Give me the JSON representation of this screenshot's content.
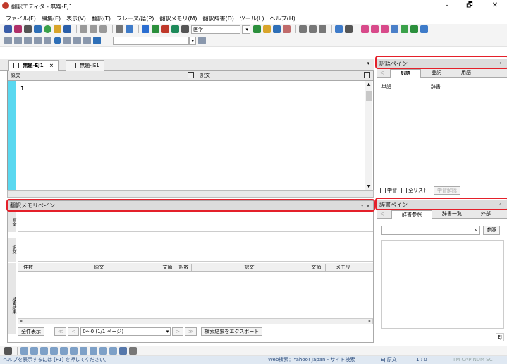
{
  "window": {
    "title": "翻訳エディタ - 無題-EJ1",
    "minimize": "–",
    "maximize": "🗗",
    "close": "✕"
  },
  "menu": [
    "ファイル(F)",
    "編集(E)",
    "表示(V)",
    "翻訳(T)",
    "フレーズ/語(P)",
    "翻訳メモリ(M)",
    "翻訳辞書(D)",
    "ツール(L)",
    "ヘルプ(H)"
  ],
  "toolbar": {
    "field_select": "医学"
  },
  "doc_tabs": [
    {
      "label": "無題-EJ1",
      "close": "×"
    },
    {
      "label": "無題-JE1"
    }
  ],
  "editor": {
    "source_header": "原文",
    "target_header": "訳文",
    "row_number": "1"
  },
  "trans_pane": {
    "title": "訳語ペイン",
    "pin": "ꟷ",
    "close": "×",
    "tabs": [
      "訳語",
      "品詞",
      "用語"
    ],
    "col_word": "単語",
    "col_dict": "辞書",
    "chk_learn": "学習",
    "chk_all": "全リスト",
    "btn_clear": "学習解除"
  },
  "memory_pane": {
    "title": "翻訳メモリペイン",
    "source_label": "原文",
    "target_label": "訳文",
    "results_label": "検索結果",
    "columns": [
      "件数",
      "原文",
      "文節",
      "訳数",
      "訳文",
      "文節",
      "メモリ"
    ],
    "btn_all": "全件表示",
    "page_info": "0〜0 (1/1 ページ)",
    "btn_export": "検索結果をエクスポート"
  },
  "dict_pane": {
    "title": "辞書ペイン",
    "tabs": [
      "辞書参照",
      "辞書一覧",
      "外部"
    ],
    "btn_ref": "参照",
    "label_ej": "EJ"
  },
  "status": {
    "help": "ヘルプを表示するには [F1] を押してください。",
    "web": "Web検索：Yahoo! Japan - サイト検索",
    "mode": "EJ 原文",
    "pos": "1 : 0",
    "ind": "TM   CAP  NUM  SC"
  },
  "colors": {
    "accent_red": "#e4202a",
    "editor_bar": "#5ad8f0"
  }
}
